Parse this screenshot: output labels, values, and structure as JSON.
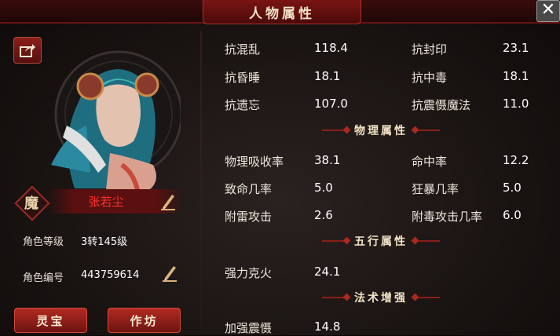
{
  "window": {
    "title": "人物属性"
  },
  "icons": {
    "close": "close-icon",
    "share": "share-icon",
    "edit": "pencil-icon"
  },
  "character": {
    "race_badge": "魔",
    "name": "张若尘",
    "level_label": "角色等级",
    "level_value": "3转145级",
    "id_label": "角色编号",
    "id_value": "443759614"
  },
  "buttons": {
    "spirit_treasure": "灵宝",
    "workshop": "作坊"
  },
  "resist": [
    {
      "label": "抗混乱",
      "value": "118.4"
    },
    {
      "label": "抗封印",
      "value": "23.1"
    },
    {
      "label": "抗昏睡",
      "value": "18.1"
    },
    {
      "label": "抗中毒",
      "value": "18.1"
    },
    {
      "label": "抗遗忘",
      "value": "107.0"
    },
    {
      "label": "抗震慑魔法",
      "value": "11.0"
    }
  ],
  "physical": {
    "title": "物理属性",
    "stats": [
      {
        "label": "物理吸收率",
        "value": "38.1"
      },
      {
        "label": "命中率",
        "value": "12.2"
      },
      {
        "label": "致命几率",
        "value": "5.0"
      },
      {
        "label": "狂暴几率",
        "value": "5.0"
      },
      {
        "label": "附雷攻击",
        "value": "2.6"
      },
      {
        "label": "附毒攻击几率",
        "value": "6.0"
      }
    ]
  },
  "elements": {
    "title": "五行属性",
    "stats": [
      {
        "label": "强力克火",
        "value": "24.1"
      }
    ]
  },
  "spell": {
    "title": "法术增强",
    "stats": [
      {
        "label": "加强震慑",
        "value": "14.8"
      }
    ]
  },
  "colors": {
    "accent_red": "#8a1e18",
    "name_red": "#ff3030",
    "title_bar": "#3a0c0c"
  }
}
